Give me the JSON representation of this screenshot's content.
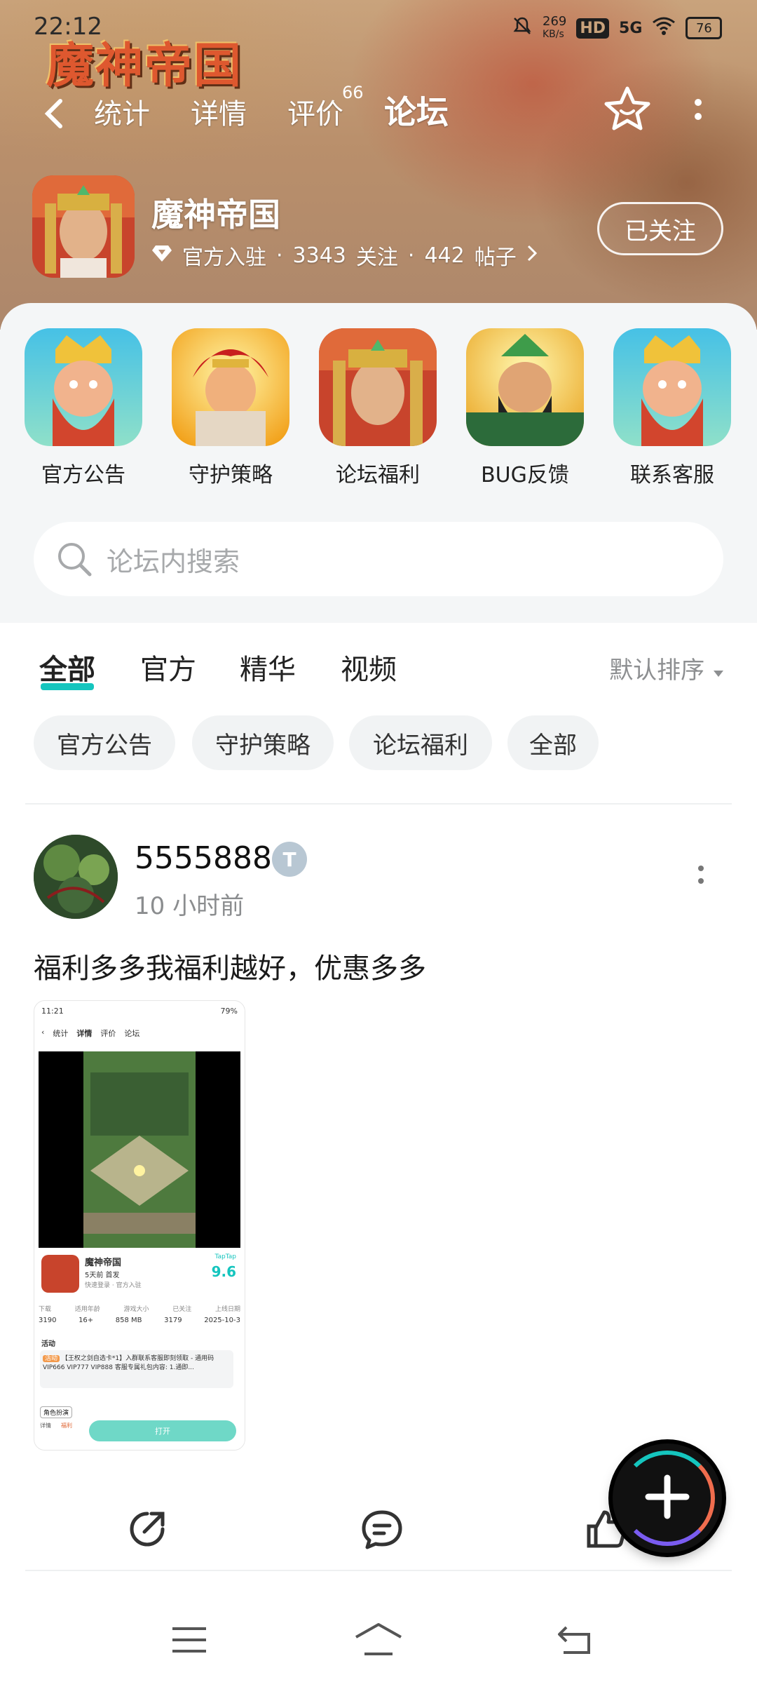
{
  "status_bar": {
    "time": "22:12",
    "net_speed": "269",
    "net_unit": "KB/s",
    "hd": "HD",
    "signal": "5G",
    "battery": "76"
  },
  "hero": {
    "logo_text": "魔神帝国",
    "nav_tabs": [
      "统计",
      "详情",
      "评价",
      "论坛"
    ],
    "rating_count": "66",
    "active_tab": "论坛"
  },
  "app": {
    "name": "魔神帝国",
    "badge": "官方入驻",
    "followers": "3343",
    "followers_label": "关注",
    "posts": "442",
    "posts_label": "帖子",
    "follow_button": "已关注"
  },
  "shortcuts": [
    {
      "label": "官方公告"
    },
    {
      "label": "守护策略"
    },
    {
      "label": "论坛福利"
    },
    {
      "label": "BUG反馈"
    },
    {
      "label": "联系客服"
    }
  ],
  "search": {
    "placeholder": "论坛内搜索"
  },
  "filter_tabs": [
    "全部",
    "官方",
    "精华",
    "视频"
  ],
  "sort_label": "默认排序",
  "chips": [
    "官方公告",
    "守护策略",
    "论坛福利",
    "全部"
  ],
  "post": {
    "username": "5555888",
    "time": "10 小时前",
    "text": "福利多多我福利越好，优惠多多",
    "thumb": {
      "time": "11:21",
      "battery": "79%",
      "tabs": [
        "统计",
        "详情",
        "评价",
        "论坛"
      ],
      "game_name": "魔神帝国",
      "release": "5天前 首发",
      "sub": "快速登录 · 官方入驻",
      "brand": "TapTap",
      "score": "9.6",
      "stats_labels": [
        "下载",
        "适用年龄",
        "游戏大小",
        "已关注",
        "上线日期"
      ],
      "stats_values": [
        "3190",
        "16+",
        "858 MB",
        "3179",
        "2025-10-3"
      ],
      "activity_title": "活动",
      "activity_tag": "活动",
      "activity_text": "【王权之剑自选卡*1】入群联系客服即刻领取 - 通用码 VIP666 VIP777 VIP888 客服专属礼包内容: 1.通即...",
      "role_tag": "角色扮演",
      "tab_labels": [
        "详情",
        "福利"
      ],
      "open_button": "打开"
    }
  }
}
